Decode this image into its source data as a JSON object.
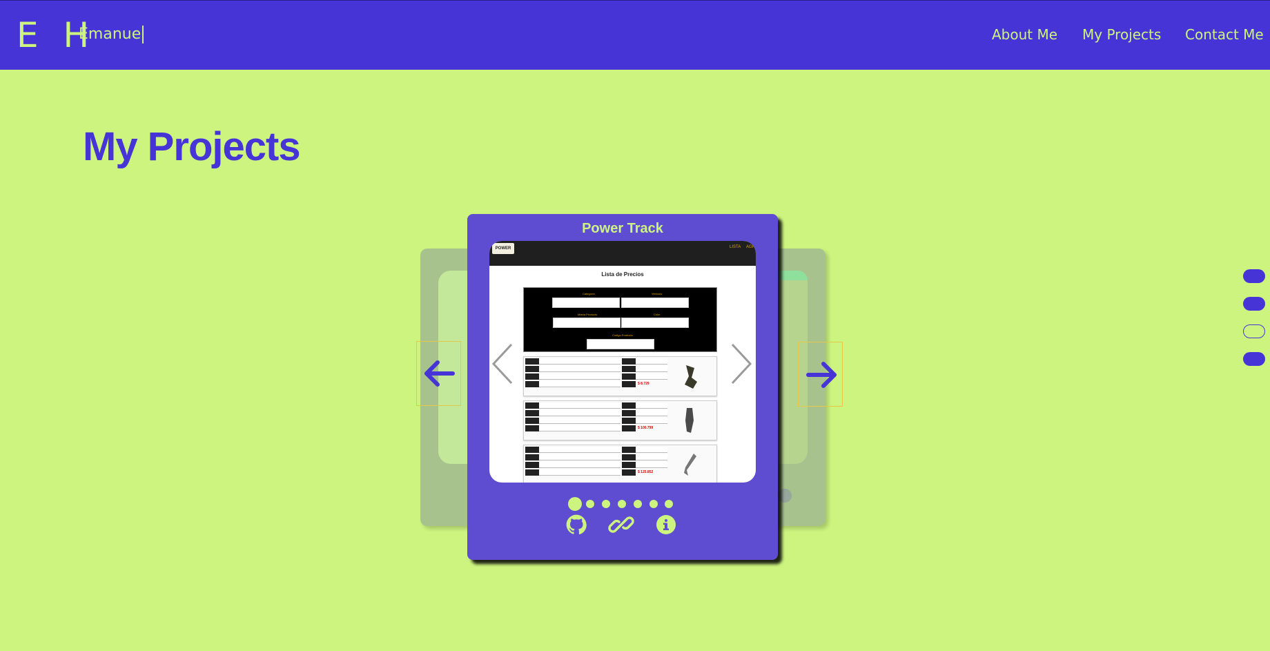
{
  "header": {
    "logo": "E H",
    "typed_name": "Emanue",
    "nav": [
      {
        "label": "About Me"
      },
      {
        "label": "My Projects"
      },
      {
        "label": "Contact Me"
      }
    ]
  },
  "main": {
    "title": "My Projects",
    "project": {
      "title": "Power Track",
      "screenshot_heading": "Lista de Precios",
      "screenshot_logo": "POWER TRACK",
      "active_slide": 1,
      "slide_count": 7
    },
    "card_actions": [
      {
        "icon": "github-icon"
      },
      {
        "icon": "link-icon"
      },
      {
        "icon": "info-icon"
      }
    ]
  },
  "section_indicators": {
    "count": 4,
    "active_index": 3
  },
  "colors": {
    "background": "#ccf47f",
    "primary": "#4634d7",
    "card": "#5e4dd0",
    "accent": "#ccf47f"
  }
}
